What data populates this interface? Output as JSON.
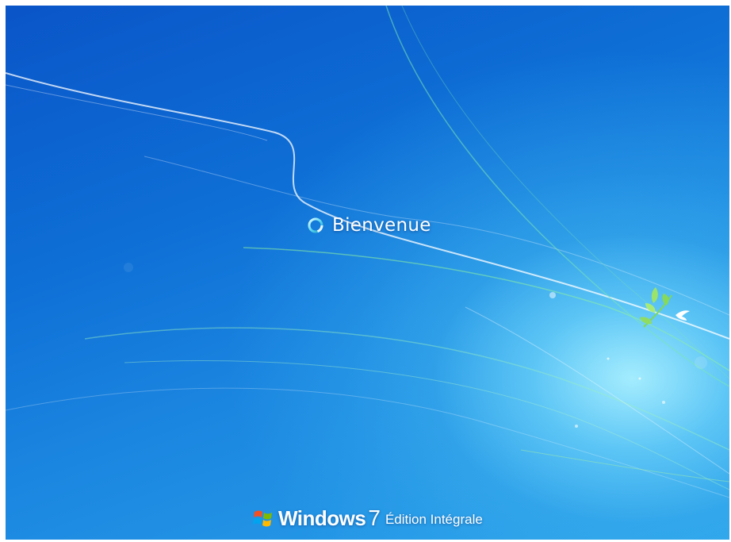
{
  "welcome": {
    "text": "Bienvenue",
    "spinner_icon": "loading-spinner-icon"
  },
  "branding": {
    "logo_icon": "windows-flag-icon",
    "product": "Windows",
    "version": "7",
    "edition": "Édition Intégrale"
  },
  "wallpaper": {
    "decoration_icon": "leaf-and-bird-icon",
    "base_color": "#0e6fd6",
    "glow_color": "#aaf0ff"
  }
}
